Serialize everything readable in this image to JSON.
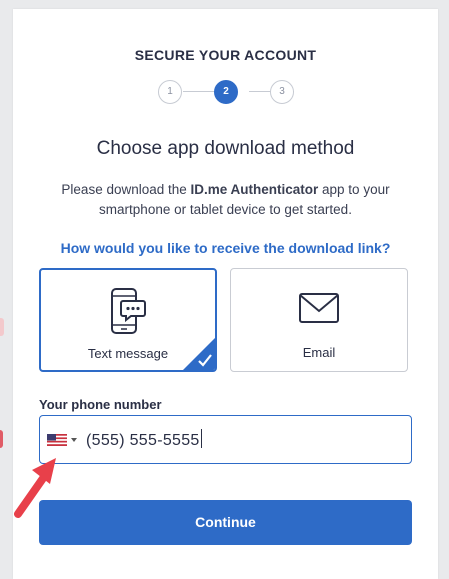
{
  "header": {
    "title": "SECURE YOUR ACCOUNT"
  },
  "stepper": {
    "steps": [
      "1",
      "2",
      "3"
    ],
    "active_step": 2
  },
  "main": {
    "title": "Choose app download method",
    "description_pre": "Please download the ",
    "description_app": "ID.me Authenticator",
    "description_post": " app to your smartphone or tablet device to get started.",
    "question": "How would you like to receive the download link?"
  },
  "options": [
    {
      "label": "Text message",
      "icon": "phone-chat-icon",
      "selected": true
    },
    {
      "label": "Email",
      "icon": "envelope-icon",
      "selected": false
    }
  ],
  "phone": {
    "label": "Your phone number",
    "country_icon": "us-flag-icon",
    "value": "(555) 555-5555"
  },
  "continue_label": "Continue",
  "colors": {
    "accent": "#2e6bc7",
    "annotation_arrow": "#e8404a"
  }
}
